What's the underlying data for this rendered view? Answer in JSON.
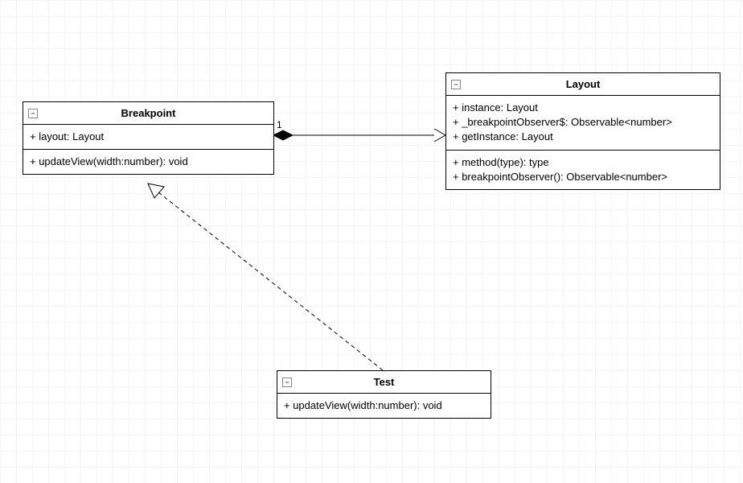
{
  "classes": {
    "breakpoint": {
      "name": "Breakpoint",
      "attributes": [
        "+ layout: Layout"
      ],
      "methods": [
        "+ updateView(width:number): void"
      ]
    },
    "layout": {
      "name": "Layout",
      "attributes": [
        "+ instance: Layout",
        "+ _breakpointObserver$: Observable<number>",
        "+ getInstance: Layout"
      ],
      "methods": [
        "+ method(type): type",
        "+ breakpointObserver(): Observable<number>"
      ]
    },
    "test": {
      "name": "Test",
      "attributes": [],
      "methods": [
        "+ updateView(width:number): void"
      ]
    }
  },
  "relationships": {
    "breakpoint_to_layout": {
      "type": "composition-navigable",
      "from": "Breakpoint",
      "to": "Layout",
      "fromMultiplicity": "1"
    },
    "test_to_breakpoint": {
      "type": "realization",
      "from": "Test",
      "to": "Breakpoint"
    }
  },
  "icons": {
    "collapse": "−"
  }
}
